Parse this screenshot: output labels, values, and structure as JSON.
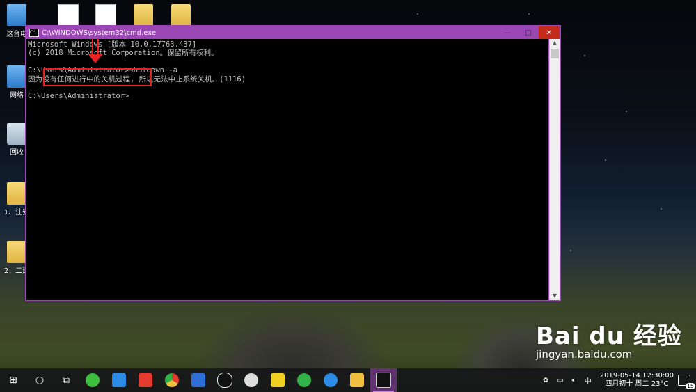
{
  "desktop": {
    "icons": [
      {
        "label": "这台电",
        "kind": "pc"
      },
      {
        "label": "网络",
        "kind": "pc"
      },
      {
        "label": "回收",
        "kind": "bin"
      },
      {
        "label": "1、注安",
        "kind": "folder"
      },
      {
        "label": "2、二建",
        "kind": "folder"
      }
    ],
    "top_icons": [
      "doc-icon",
      "doc-icon",
      "folder-icon",
      "folder-icon"
    ]
  },
  "cmd_window": {
    "title": "C:\\WINDOWS\\system32\\cmd.exe",
    "icon_text": "C:\\",
    "min": "—",
    "max": "□",
    "close": "✕",
    "lines": [
      "Microsoft Windows [版本 10.0.17763.437]",
      "(c) 2018 Microsoft Corporation。保留所有权利。",
      "",
      "C:\\Users\\Administrator>shutdown -a",
      "因为没有任何进行中的关机过程, 所以无法中止系统关机。(1116)",
      "",
      "C:\\Users\\Administrator>"
    ],
    "scroll_up": "▲",
    "scroll_down": "▼"
  },
  "taskbar": {
    "apps": [
      {
        "name": "start-icon",
        "glyph": "⊞",
        "color": ""
      },
      {
        "name": "cortana-icon",
        "glyph": "○",
        "color": ""
      },
      {
        "name": "task-view-icon",
        "glyph": "⧉",
        "color": ""
      },
      {
        "name": "wechat-icon",
        "glyph": "",
        "color": "#3fbf3f"
      },
      {
        "name": "app-blue-icon",
        "glyph": "",
        "color": "#2b8be6"
      },
      {
        "name": "app-red-icon",
        "glyph": "",
        "color": "#e33b2e"
      },
      {
        "name": "chrome-icon",
        "glyph": "",
        "color": "#e0a020"
      },
      {
        "name": "app-cloud-icon",
        "glyph": "",
        "color": "#2d6fd6"
      },
      {
        "name": "qq-icon",
        "glyph": "",
        "color": "#111"
      },
      {
        "name": "cat-icon",
        "glyph": "",
        "color": "#ddd"
      },
      {
        "name": "app-yellow-icon",
        "glyph": "",
        "color": "#f2d022"
      },
      {
        "name": "app-green-icon",
        "glyph": "",
        "color": "#33b24a"
      },
      {
        "name": "ie-icon",
        "glyph": "",
        "color": "#2b8be6"
      },
      {
        "name": "explorer-icon",
        "glyph": "",
        "color": "#f2c040"
      },
      {
        "name": "cmd-icon",
        "glyph": "",
        "color": "#111"
      }
    ],
    "tray": {
      "ime": "中",
      "date": "2019-05-14",
      "time": "12:30:00",
      "lunar": "四月初十 周二 23°C",
      "notifications": "15"
    }
  },
  "watermark": {
    "brand": "Bai du 经验",
    "url": "jingyan.baidu.com"
  }
}
